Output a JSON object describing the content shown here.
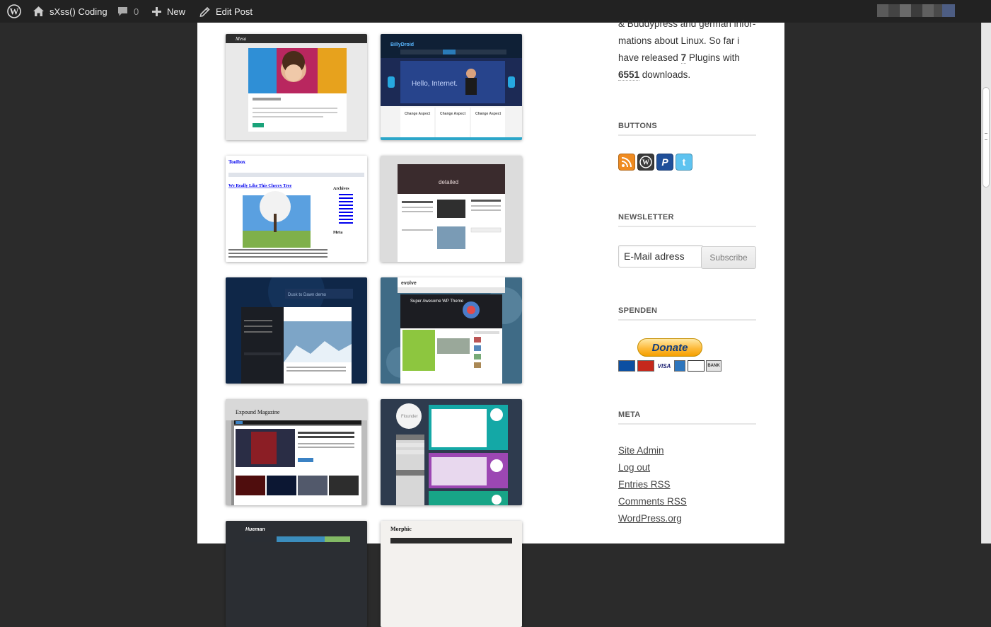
{
  "adminbar": {
    "site_name": "sXss() Coding",
    "comment_count": "0",
    "new_label": "New",
    "edit_label": "Edit Post"
  },
  "sidebar": {
    "intro": {
      "line1": "& Buddypress and german infor-",
      "line2": "mations about Linux. So far i",
      "line3_pre": "have released ",
      "plugins": "7",
      "line3_post": " Plugins with",
      "downloads": "6551",
      "line4_post": " downloads."
    },
    "buttons_title": "BUTTONS",
    "buttons": [
      {
        "icon": "rss-icon",
        "color": "#ef8b21"
      },
      {
        "icon": "wordpress-icon",
        "color": "#3b3b3b"
      },
      {
        "icon": "paypal-icon",
        "color": "#1f4f99"
      },
      {
        "icon": "twitter-icon",
        "color": "#5ec3f0"
      }
    ],
    "newsletter_title": "NEWSLETTER",
    "email_placeholder": "E-Mail adress",
    "subscribe_label": "Subscribe",
    "spenden_title": "SPENDEN",
    "donate_label": "Donate",
    "cards": [
      "Maestro",
      "MasterCard",
      "VISA",
      "AMEX",
      "DISCOVER",
      "BANK"
    ],
    "meta_title": "META",
    "meta_links": [
      "Site Admin",
      "Log out",
      "Entries RSS",
      "Comments RSS",
      "WordPress.org"
    ]
  },
  "thumbnails": [
    {
      "name": "Mesa",
      "title": "Mesa"
    },
    {
      "name": "BillyDroid",
      "title": "BillyDroid",
      "hero": "Hello, Internet.",
      "boxes": [
        "Change Aspect",
        "Change Aspect",
        "Change Aspect"
      ]
    },
    {
      "name": "Toolbox",
      "title": "Toolbox",
      "post_title": "We Really Like This Cherry Tree",
      "side_title": "Archives",
      "meta": "Meta"
    },
    {
      "name": "Detailed",
      "title": "detailed"
    },
    {
      "name": "Dusk to Dawn",
      "title": "Dusk to Dawn demo"
    },
    {
      "name": "evolve",
      "title": "evolve",
      "hero": "Super Awesome WP Theme"
    },
    {
      "name": "Expound",
      "title": "Expound Magazine"
    },
    {
      "name": "Flounder",
      "title": "Flounder"
    },
    {
      "name": "Hueman",
      "title": "Hueman"
    },
    {
      "name": "Morphic",
      "title": "Morphic"
    }
  ],
  "colors": {
    "adminbar_bg": "#222222",
    "page_bg": "#ffffff",
    "outer_bg": "#2b2b2b"
  }
}
